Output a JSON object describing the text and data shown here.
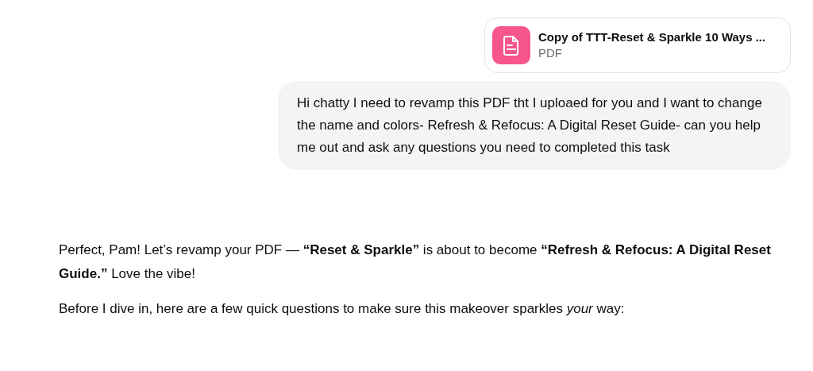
{
  "attachment": {
    "name": "Copy of TTT-Reset & Sparkle 10 Ways ...",
    "type": "PDF"
  },
  "user_message": "Hi chatty I need to revamp this PDF tht I uploaed for you and I want to change the name and colors- Refresh & Refocus: A Digital Reset Guide- can you help me out and ask any questions you need to completed this task",
  "assistant_paragraphs": [
    "Perfect, Pam! Let’s revamp your PDF — **“Reset & Sparkle”** is about to become **“Refresh & Refocus: A Digital Reset Guide.”** Love the vibe!",
    "Before I dive in, here are a few quick questions to make sure this makeover sparkles *your* way:"
  ]
}
